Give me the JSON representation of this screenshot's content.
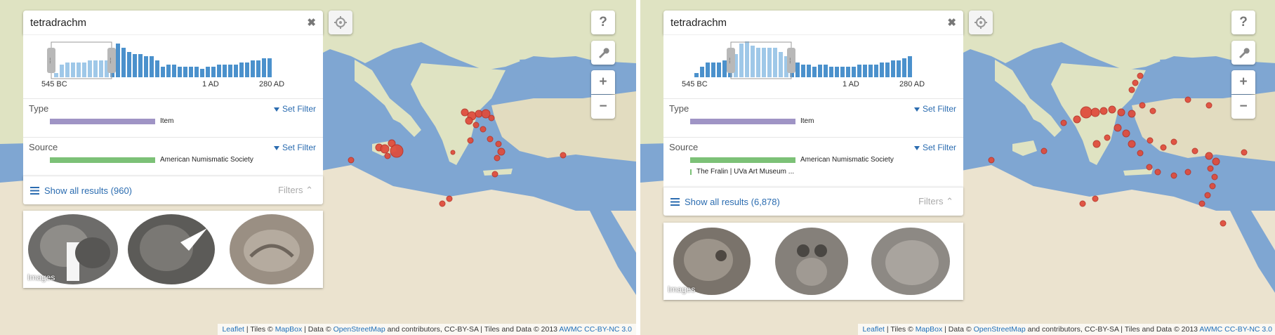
{
  "panels": [
    {
      "search": {
        "value": "tetradrachm",
        "clear_label": "✖"
      },
      "timeline": {
        "labels": [
          "545 BC",
          "1 AD",
          "280 AD"
        ],
        "bars": [
          2,
          6,
          7,
          7,
          7,
          7,
          8,
          8,
          8,
          8,
          12,
          16,
          14,
          12,
          11,
          11,
          10,
          10,
          8,
          5,
          6,
          6,
          5,
          5,
          5,
          5,
          4,
          5,
          5,
          6,
          6,
          6,
          6,
          7,
          7,
          8,
          8,
          9,
          9
        ]
      },
      "type_facet": {
        "title": "Type",
        "set_filter": "Set Filter",
        "items": [
          {
            "label": "Item",
            "fraction": 1.0,
            "color": "#9f94c5"
          }
        ]
      },
      "source_facet": {
        "title": "Source",
        "set_filter": "Set Filter",
        "items": [
          {
            "label": "American Numismatic Society",
            "fraction": 1.0,
            "color": "#7cc177"
          }
        ]
      },
      "results": {
        "label": "Show all results (960)",
        "filters_label": "Filters"
      },
      "images": {
        "caption": "Images"
      },
      "map_controls": {
        "help": "?",
        "zoom_in": "+",
        "zoom_out": "−"
      }
    },
    {
      "search": {
        "value": "tetradrachm",
        "clear_label": "✖"
      },
      "timeline": {
        "labels": [
          "545 BC",
          "1 AD",
          "280 AD"
        ],
        "bars": [
          2,
          5,
          7,
          7,
          7,
          8,
          9,
          11,
          16,
          17,
          15,
          14,
          14,
          14,
          14,
          12,
          10,
          8,
          7,
          6,
          6,
          5,
          6,
          6,
          5,
          5,
          5,
          5,
          5,
          6,
          6,
          6,
          6,
          7,
          7,
          8,
          8,
          9,
          10
        ]
      },
      "type_facet": {
        "title": "Type",
        "set_filter": "Set Filter",
        "items": [
          {
            "label": "Item",
            "fraction": 1.0,
            "color": "#9f94c5"
          }
        ]
      },
      "source_facet": {
        "title": "Source",
        "set_filter": "Set Filter",
        "items": [
          {
            "label": "American Numismatic Society",
            "fraction": 1.0,
            "color": "#7cc177"
          },
          {
            "label": "The Fralin | UVa Art Museum ...",
            "fraction": 0.02,
            "color": "#7cc177"
          }
        ]
      },
      "results": {
        "label": "Show all results (6,878)",
        "filters_label": "Filters"
      },
      "images": {
        "caption": "Images"
      },
      "map_controls": {
        "help": "?",
        "zoom_in": "+",
        "zoom_out": "−"
      }
    }
  ],
  "attribution": {
    "leaflet": "Leaflet",
    "tiles_prefix": " | Tiles © ",
    "mapbox": "MapBox",
    "data_prefix": " | Data © ",
    "osm": "OpenStreetMap",
    "osm_suffix": " and contributors, CC-BY-SA | Tiles and Data © 2013 ",
    "awmc": "AWMC CC-BY-NC 3.0"
  },
  "colors": {
    "map_sea": "#7fa6d2",
    "land": "#e6dfc8",
    "marker": "#e04a3a",
    "link": "#2b6cb0"
  },
  "icons": [
    "gear-icon",
    "wrench-icon",
    "list-icon",
    "filter-icon",
    "chevron-up-icon",
    "close-icon"
  ]
}
